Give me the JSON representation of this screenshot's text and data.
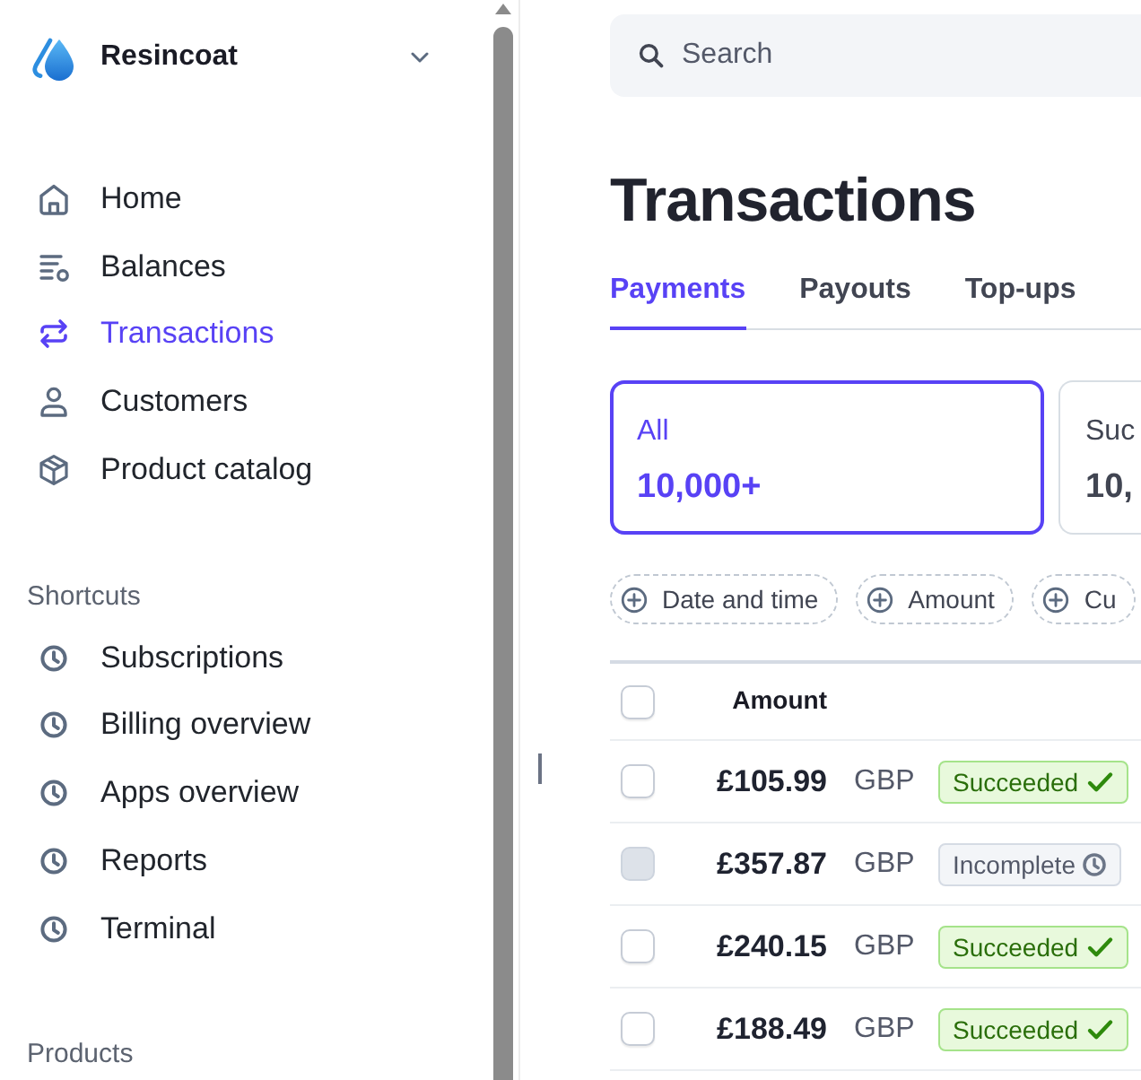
{
  "sidebar": {
    "account": {
      "name": "Resincoat"
    },
    "nav_items": [
      {
        "label": "Home",
        "selected": false
      },
      {
        "label": "Balances",
        "selected": false
      },
      {
        "label": "Transactions",
        "selected": true
      },
      {
        "label": "Customers",
        "selected": false
      },
      {
        "label": "Product catalog",
        "selected": false
      }
    ],
    "sections": [
      {
        "heading": "Shortcuts",
        "items": [
          {
            "label": "Subscriptions"
          },
          {
            "label": "Billing overview"
          },
          {
            "label": "Apps overview"
          },
          {
            "label": "Reports"
          },
          {
            "label": "Terminal"
          }
        ]
      },
      {
        "heading": "Products"
      }
    ]
  },
  "main": {
    "search": {
      "placeholder": "Search"
    },
    "title": "Transactions",
    "tabs": [
      {
        "label": "Payments",
        "selected": true
      },
      {
        "label": "Payouts",
        "selected": false
      },
      {
        "label": "Top-ups",
        "selected": false
      }
    ],
    "status_cards": [
      {
        "label": "All",
        "count": "10,000+",
        "selected": true
      },
      {
        "label": "Suc",
        "count": "10,",
        "selected": false
      }
    ],
    "filters": [
      {
        "label": "Date and time"
      },
      {
        "label": "Amount"
      },
      {
        "label": "Cu"
      }
    ],
    "table": {
      "header_checkbox": {
        "checked": false
      },
      "columns": [
        {
          "label": "Amount"
        }
      ],
      "rows": [
        {
          "checked": false,
          "disabled": false,
          "amount": "£105.99",
          "currency": "GBP",
          "status": {
            "kind": "succeeded",
            "label": "Succeeded"
          }
        },
        {
          "checked": false,
          "disabled": true,
          "amount": "£357.87",
          "currency": "GBP",
          "status": {
            "kind": "incomplete",
            "label": "Incomplete"
          }
        },
        {
          "checked": false,
          "disabled": false,
          "amount": "£240.15",
          "currency": "GBP",
          "status": {
            "kind": "succeeded",
            "label": "Succeeded"
          }
        },
        {
          "checked": false,
          "disabled": false,
          "amount": "£188.49",
          "currency": "GBP",
          "status": {
            "kind": "succeeded",
            "label": "Succeeded"
          }
        }
      ]
    }
  }
}
